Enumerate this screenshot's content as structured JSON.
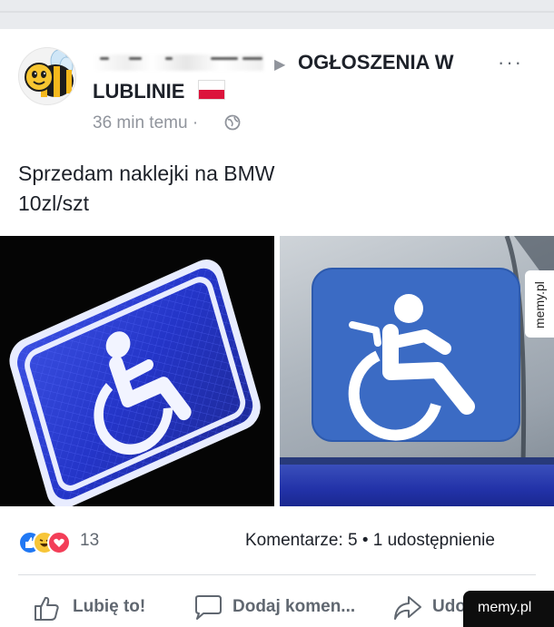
{
  "post": {
    "group_name": "OGŁOSZENIA W",
    "group_name_line2": "LUBLINIE",
    "timestamp": "36 min temu",
    "timestamp_separator": "·",
    "text_line1": "Sprzedam naklejki na BMW",
    "text_line2": "10zl/szt",
    "more_options": "···"
  },
  "stats": {
    "reaction_count": "13",
    "comments_shares": "Komentarze: 5 • 1 udostępnienie",
    "reactions": [
      "like-icon",
      "haha-icon",
      "love-icon"
    ]
  },
  "actions": {
    "like_label": "Lubię to!",
    "comment_label": "Dodaj komen...",
    "share_label": "Udo"
  },
  "watermarks": {
    "side": "memy.pl",
    "badge": "memy.pl"
  },
  "colors": {
    "facebook_blue": "#2078f4",
    "wheelchair_sign_blue": "#3a6fc7",
    "text_primary": "#1d2129",
    "text_secondary": "#90949c"
  }
}
